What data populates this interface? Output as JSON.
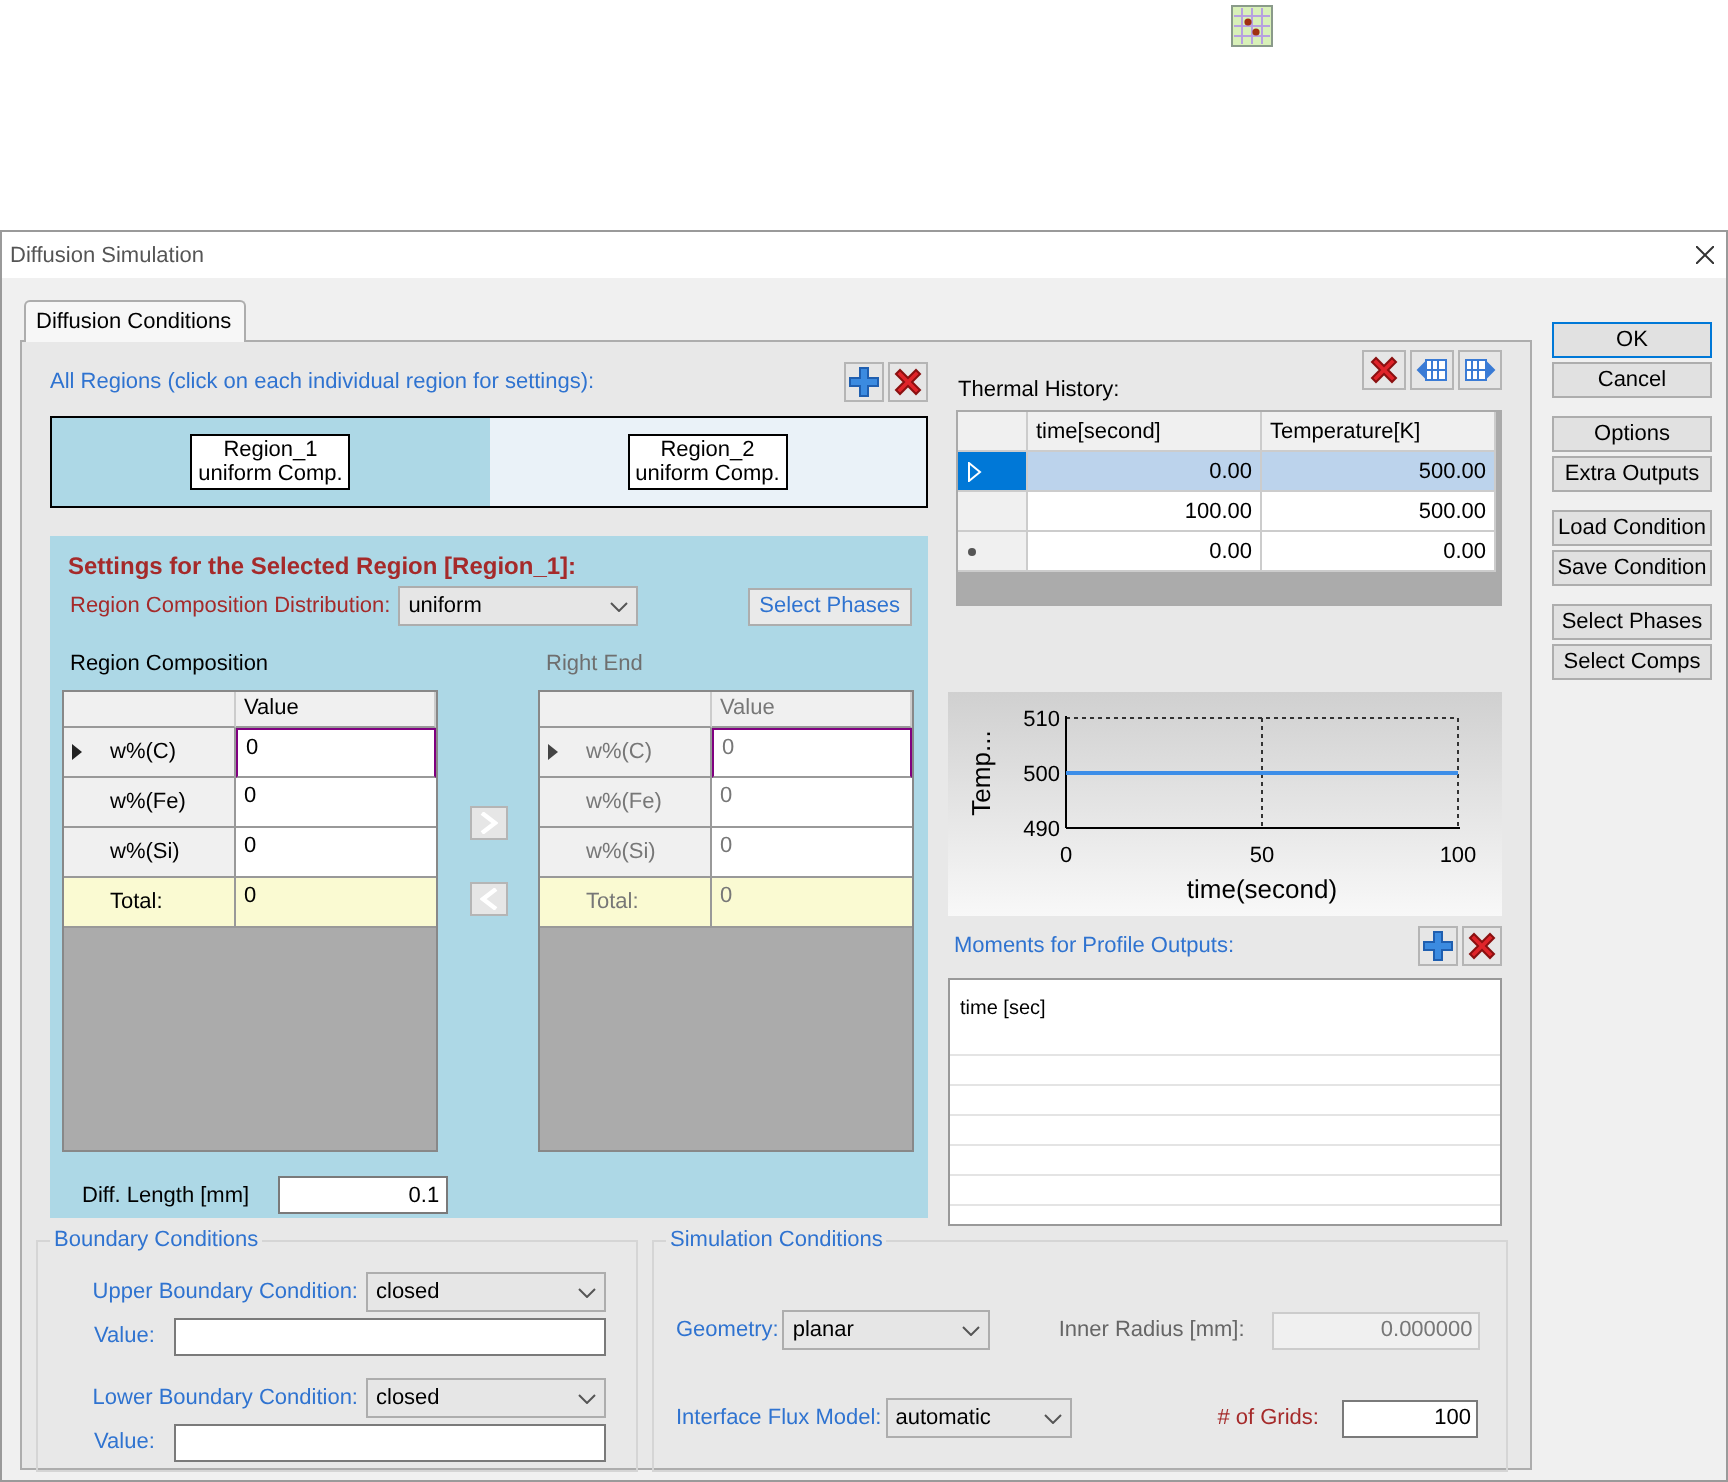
{
  "window": {
    "title": "Diffusion Simulation"
  },
  "tabs": [
    {
      "label": "Diffusion Conditions",
      "selected": true
    }
  ],
  "regions": {
    "label": "All Regions (click on each individual region for settings):",
    "items": [
      {
        "name": "Region_1",
        "type": "uniform Comp.",
        "selected": true
      },
      {
        "name": "Region_2",
        "type": "uniform Comp.",
        "selected": false
      }
    ]
  },
  "settings": {
    "title": "Settings for the Selected Region [Region_1]:",
    "distribution_label": "Region Composition Distribution:",
    "distribution": "uniform",
    "select_phases": "Select Phases",
    "grids": [
      {
        "title": "Region Composition",
        "column": "Value",
        "disabled": false,
        "rows": [
          {
            "kind": "element",
            "label": "w%(C)",
            "value": "0",
            "current": true
          },
          {
            "kind": "element",
            "label": "w%(Fe)",
            "value": "0",
            "current": false
          },
          {
            "kind": "element",
            "label": "w%(Si)",
            "value": "0",
            "current": false
          },
          {
            "kind": "total",
            "label": "Total:",
            "value": "0",
            "current": false
          }
        ]
      },
      {
        "title": "Right End",
        "column": "Value",
        "disabled": true,
        "rows": [
          {
            "kind": "element",
            "label": "w%(C)",
            "value": "0",
            "current": true
          },
          {
            "kind": "element",
            "label": "w%(Fe)",
            "value": "0",
            "current": false
          },
          {
            "kind": "element",
            "label": "w%(Si)",
            "value": "0",
            "current": false
          },
          {
            "kind": "total",
            "label": "Total:",
            "value": "0",
            "current": false
          }
        ]
      }
    ],
    "diff_length_label": "Diff. Length [mm]",
    "diff_length": "0.1"
  },
  "thermal_history": {
    "label": "Thermal History:",
    "columns": [
      "time[second]",
      "Temperature[K]"
    ],
    "rows": [
      {
        "kind": "current",
        "cells": [
          "0.00",
          "500.00"
        ],
        "selected": true
      },
      {
        "kind": "normal",
        "cells": [
          "100.00",
          "500.00"
        ],
        "selected": false
      },
      {
        "kind": "new",
        "cells": [
          "0.00",
          "0.00"
        ],
        "selected": false
      }
    ]
  },
  "chart": {
    "chart_data": {
      "type": "line",
      "xlabel": "time(second)",
      "ylabel": "Temp...",
      "x": [
        0,
        100
      ],
      "series": [
        {
          "color": "#3d8ee8",
          "values": [
            500,
            500
          ]
        }
      ],
      "xlim": [
        0,
        100
      ],
      "ylim": [
        490,
        510
      ],
      "xticks": [
        0,
        50,
        100
      ],
      "yticks": [
        490,
        500,
        510
      ]
    }
  },
  "moments": {
    "label": "Moments for Profile Outputs:",
    "items": [
      "time [sec]"
    ]
  },
  "boundary": {
    "title": "Boundary Conditions",
    "rows": [
      {
        "label": "Upper Boundary Condition:",
        "choice": "closed",
        "value_label": "Value:",
        "value": ""
      },
      {
        "label": "Lower Boundary Condition:",
        "choice": "closed",
        "value_label": "Value:",
        "value": ""
      }
    ]
  },
  "simulation": {
    "title": "Simulation Conditions",
    "geometry_label": "Geometry:",
    "geometry": "planar",
    "inner_radius_label": "Inner Radius [mm]:",
    "inner_radius": "0.000000",
    "inner_radius_disabled": true,
    "flux_label": "Interface Flux Model:",
    "flux": "automatic",
    "grids_label": "# of Grids:",
    "grids": "100"
  },
  "button_groups": [
    [
      {
        "label": "OK",
        "default": true
      },
      {
        "label": "Cancel",
        "default": false
      }
    ],
    [
      {
        "label": "Options",
        "default": false
      },
      {
        "label": "Extra Outputs",
        "default": false
      }
    ],
    [
      {
        "label": "Load Condition",
        "default": false
      },
      {
        "label": "Save Condition",
        "default": false
      }
    ],
    [
      {
        "label": "Select Phases",
        "default": false
      },
      {
        "label": "Select Comps",
        "default": false
      }
    ]
  ]
}
